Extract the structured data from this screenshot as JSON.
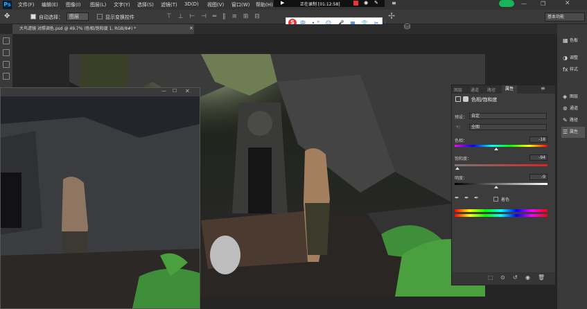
{
  "app": {
    "logo": "Ps",
    "document_tab": "大鸟滤镜 对照调色.psd @ 49.7% (色相/饱和度 1, RGB/8#) *"
  },
  "menu": [
    "文件(F)",
    "编辑(E)",
    "图像(I)",
    "图层(L)",
    "文字(Y)",
    "选择(S)",
    "滤镜(T)",
    "3D(D)",
    "视图(V)",
    "窗口(W)",
    "帮助(H)"
  ],
  "recording": {
    "label": "正在录制 [01:12:58]"
  },
  "options": {
    "auto_select_label": "自动选择：",
    "auto_select_value": "图层",
    "show_transform_label": "显示变换控件"
  },
  "workspace": "基本功能",
  "dock": [
    "色板",
    "调整",
    "样式",
    "图层",
    "通道",
    "路径",
    "属性"
  ],
  "properties": {
    "tabs": [
      "图层",
      "通道",
      "路径",
      "属性"
    ],
    "adjustment_title": "色相/饱和度",
    "preset_label": "预设：",
    "preset_value": "自定",
    "channel_value": "全图",
    "hue_label": "色相：",
    "hue_value": "-18",
    "saturation_label": "饱和度：",
    "saturation_value": "-94",
    "lightness_label": "明度：",
    "lightness_value": "-9",
    "colorize_label": "着色",
    "hue_pos": 0.45,
    "sat_pos": 0.03,
    "light_pos": 0.45
  },
  "colors": {
    "accent": "#31a8ff",
    "panel": "#3c3c3c",
    "dark": "#282828"
  }
}
